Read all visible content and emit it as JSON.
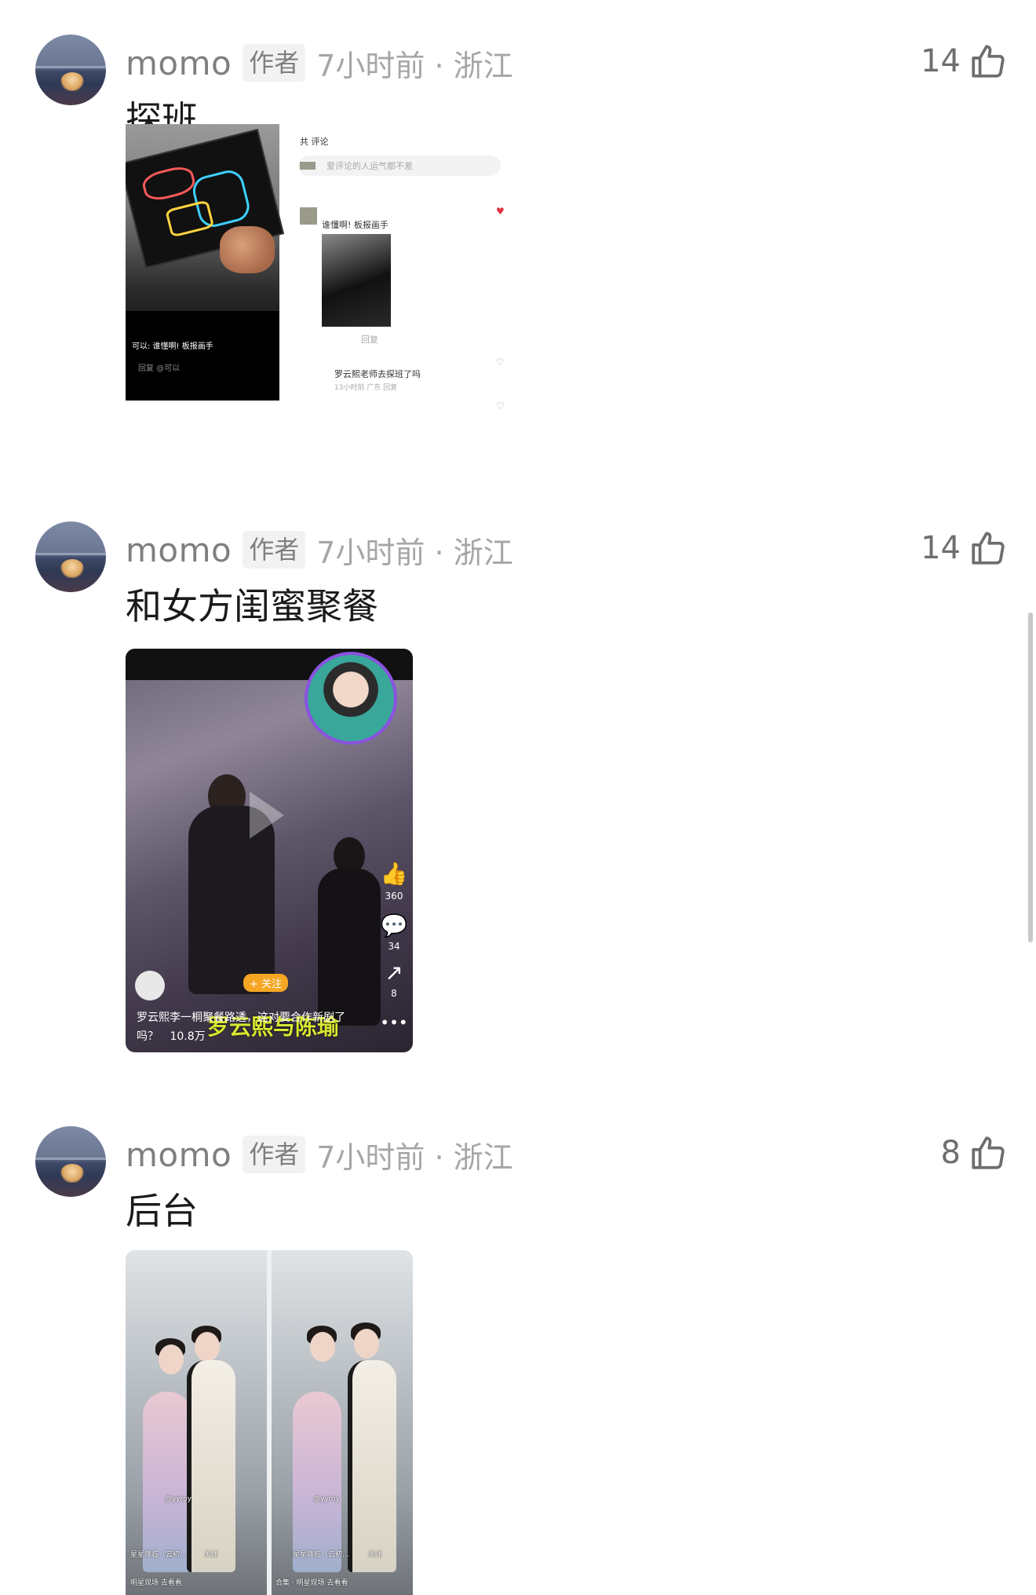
{
  "comments": [
    {
      "username": "momo",
      "author_tag": "作者",
      "meta": "7小时前 · 浙江",
      "likes": "14",
      "text": "探班",
      "media": {
        "left_caption": "可以: 谁懂啊! 板报画手",
        "left_input": "回复 @可以",
        "right_header": "共 评论",
        "right_input_placeholder": "爱评论的人运气都不差",
        "right_comment": "谁懂啊! 板报画手",
        "right_reply": "回复",
        "right_question": "罗云熙老师去探班了吗",
        "right_question_meta": "13小时前 广东 回复"
      }
    },
    {
      "username": "momo",
      "author_tag": "作者",
      "meta": "7小时前 · 浙江",
      "likes": "14",
      "text": "和女方闺蜜聚餐",
      "media": {
        "likes_count": "360",
        "comments_count": "34",
        "shares_count": "8",
        "follow_label": "+ 关注",
        "caption": "罗云熙李一桐聚餐路透，这对要合作新剧了吗？",
        "views": "10.8万",
        "overlay_text": "罗云熙与陈瑜"
      }
    },
    {
      "username": "momo",
      "author_tag": "作者",
      "meta": "7小时前 · 浙江",
      "likes": "8",
      "text": "后台",
      "media": {
        "watermark": "@yyroy",
        "left_caption": "星星降临（云初...",
        "right_caption": "星星降临（云初...",
        "follow": "关注",
        "footer_left": "明星现场  去看看",
        "footer_right": "合集 · 明星现场  去看看"
      }
    }
  ],
  "colors": {
    "username": "#7f7f7f",
    "meta": "#a6a6a6",
    "text": "#1a1a1a",
    "tag_bg": "#f2f2f2"
  },
  "icons": {
    "like": "thumbs-up-icon"
  }
}
